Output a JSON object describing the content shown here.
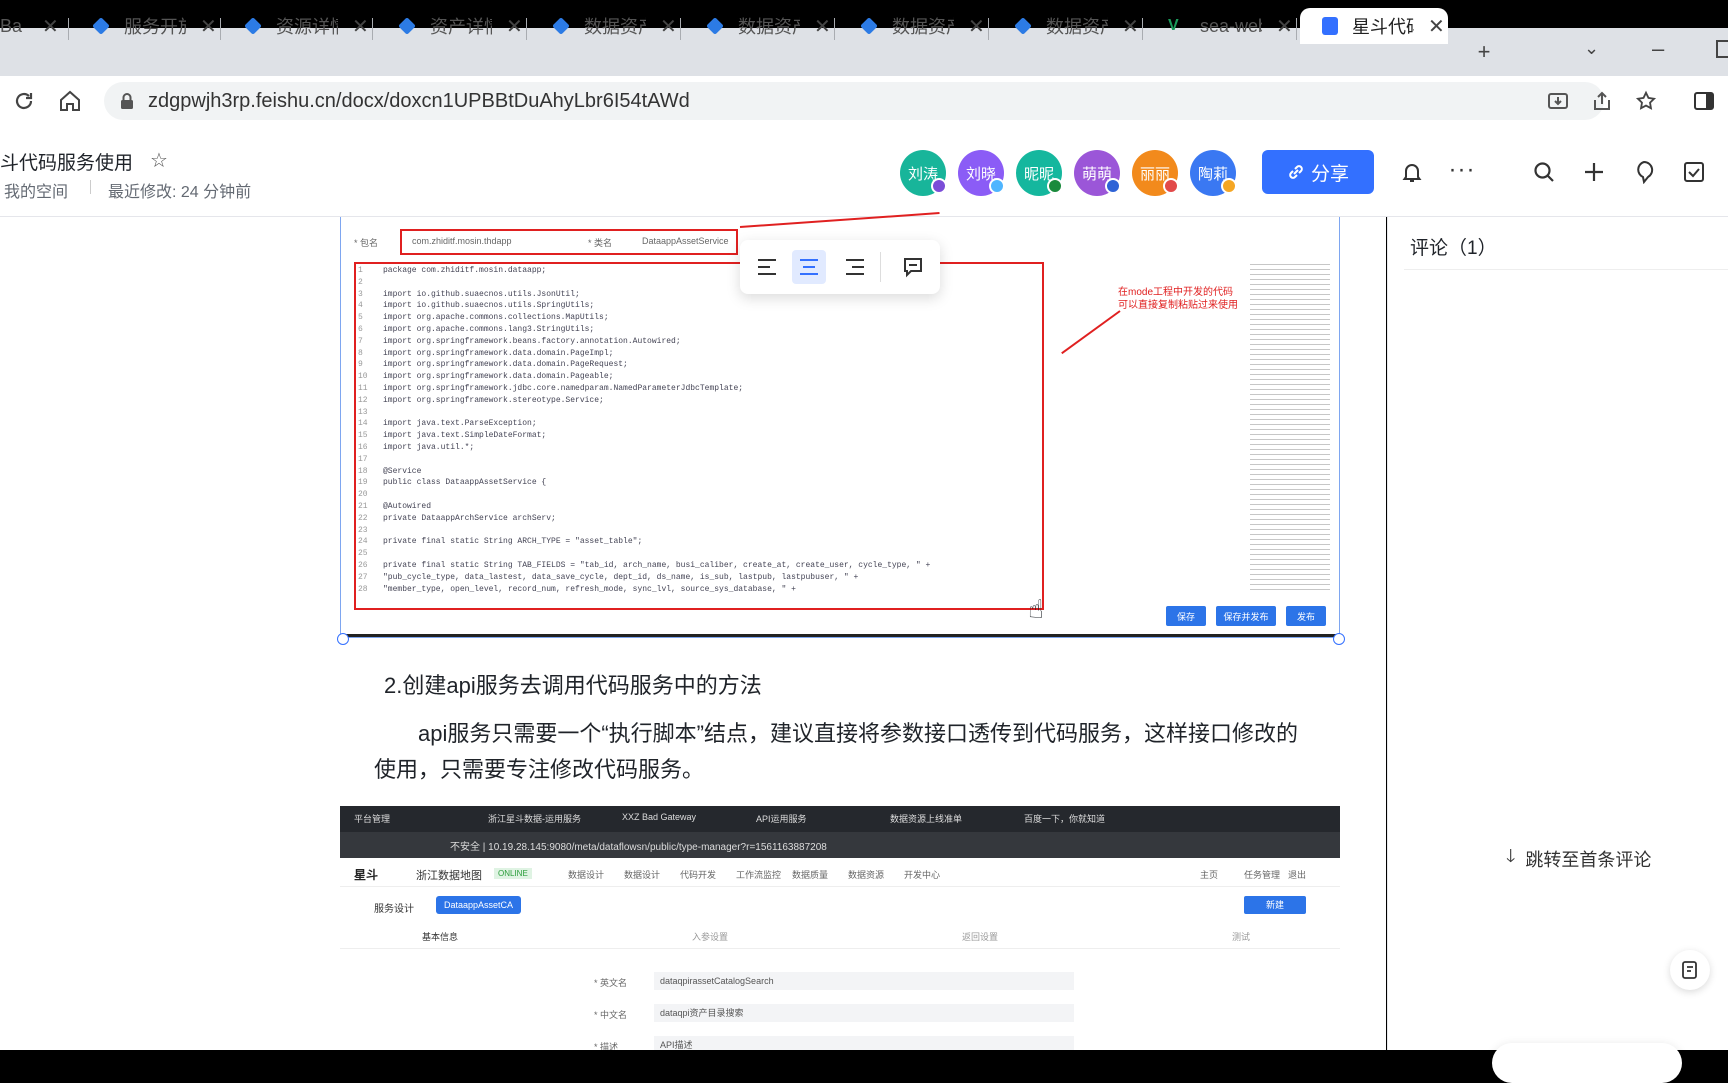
{
  "browser": {
    "tabs": [
      {
        "title": "Ba",
        "icon": "generic-tab-icon"
      },
      {
        "title": "服务开放",
        "icon": "diamond-icon"
      },
      {
        "title": "资源详情",
        "icon": "diamond-icon"
      },
      {
        "title": "资产详情",
        "icon": "diamond-icon"
      },
      {
        "title": "数据资产",
        "icon": "diamond-icon"
      },
      {
        "title": "数据资产",
        "icon": "diamond-icon"
      },
      {
        "title": "数据资产",
        "icon": "diamond-icon"
      },
      {
        "title": "数据资产",
        "icon": "diamond-icon"
      },
      {
        "title": "sea-web",
        "icon": "vue-icon"
      },
      {
        "title": "星斗代码",
        "icon": "doc-icon"
      }
    ],
    "url": "zdgpwjh3rp.feishu.cn/docx/doxcn1UPBBtDuAhyLbr6I54tAWd",
    "new_tab": "+"
  },
  "doc": {
    "title": "斗代码服务使用",
    "breadcrumb_space": "我的空间",
    "last_modified": "最近修改: 24 分钟前",
    "collaborators": [
      {
        "name": "刘涛",
        "color": "#18b59a",
        "status": "#7b4dd8"
      },
      {
        "name": "刘晓",
        "color": "#8b5cf6",
        "status": "#4fb5ff"
      },
      {
        "name": "昵昵",
        "color": "#15b79e",
        "status": "#1a8a3c"
      },
      {
        "name": "萌萌",
        "color": "#9b56d8",
        "status": "#2e63d6"
      },
      {
        "name": "丽丽",
        "color": "#f28a1c",
        "status": "#e24a4a"
      },
      {
        "name": "陶莉",
        "color": "#3a78f2",
        "status": "#f5a623"
      }
    ],
    "share_label": "分享"
  },
  "content": {
    "heading": "2.创建api服务去调用代码服务中的方法",
    "paragraph_line1": "api服务只需要一个“执行脚本”结点，建议直接将参数接口透传到代码服务，这样接口修改的",
    "paragraph_line2": "使用，只需要专注修改代码服务。",
    "screenshot1": {
      "package_field": "com.zhiditf.mosin.thdapp",
      "class_field": "DataappAssetService",
      "annotation": "在mode工程中开发的代码\n可以直接复制粘贴过来使用",
      "code": [
        "package com.zhiditf.mosin.dataapp;",
        "",
        "import io.github.suaecnos.utils.JsonUtil;",
        "import io.github.suaecnos.utils.SpringUtils;",
        "import org.apache.commons.collections.MapUtils;",
        "import org.apache.commons.lang3.StringUtils;",
        "import org.springframework.beans.factory.annotation.Autowired;",
        "import org.springframework.data.domain.PageImpl;",
        "import org.springframework.data.domain.PageRequest;",
        "import org.springframework.data.domain.Pageable;",
        "import org.springframework.jdbc.core.namedparam.NamedParameterJdbcTemplate;",
        "import org.springframework.stereotype.Service;",
        "",
        "import java.text.ParseException;",
        "import java.text.SimpleDateFormat;",
        "import java.util.*;",
        "",
        "@Service",
        "public class DataappAssetService {",
        "",
        "    @Autowired",
        "    private DataappArchService archServ;",
        "",
        "    private final static String ARCH_TYPE = \"asset_table\";",
        "",
        "    private final static String TAB_FIELDS = \"tab_id, arch_name, busi_caliber, create_at, create_user, cycle_type, \" +",
        "          \"pub_cycle_type, data_lastest, data_save_cycle, dept_id, ds_name, is_sub, lastpub, lastpubuser, \" +",
        "          \"member_type, open_level, record_num, refresh_mode, sync_lvl, source_sys_database, \" +"
      ],
      "buttons": [
        "保存",
        "保存并发布",
        "发布"
      ]
    },
    "screenshot2": {
      "tabs": [
        "平台管理",
        "浙江星斗数据-运用服务",
        "XXZ Bad Gateway",
        "API运用服务",
        "数据资源上线准单",
        "百度一下，你就知道"
      ],
      "url": "不安全 | 10.19.28.145:9080/meta/dataflowsn/public/type-manager?r=1561163887208",
      "app_name": "星斗",
      "project": "浙江数据地图",
      "project_badge": "ONLINE",
      "menu": [
        "数据设计",
        "数据设计",
        "代码开发",
        "工作流监控",
        "数据质量",
        "数据资源",
        "开发中心"
      ],
      "header_right": [
        "主页",
        "任务管理",
        "退出"
      ],
      "service_label": "服务设计",
      "service_tag": "DataappAssetCA",
      "create_btn": "新建",
      "form_cols": [
        "基本信息",
        "入参设置",
        "返回设置",
        "测试"
      ],
      "form_fields": [
        {
          "label": "英文名",
          "value": "dataqpirassetCatalogSearch"
        },
        {
          "label": "中文名",
          "value": "dataqpi资产目录搜索"
        },
        {
          "label": "描述",
          "value": "API描述"
        }
      ]
    }
  },
  "comments": {
    "title": "评论（1）",
    "jump_label": "跳转至首条评论"
  }
}
